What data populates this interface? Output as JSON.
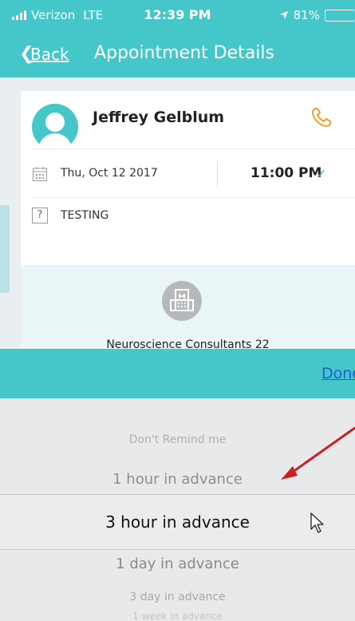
{
  "status_bar": {
    "carrier": "Verizon",
    "network": "LTE",
    "time": "12:39 PM",
    "battery": "81%",
    "battery_level": 0.81
  },
  "nav": {
    "back_label": "Back",
    "title": "Appointment Details"
  },
  "appointment": {
    "patient_name": "Jeffrey Gelblum",
    "date": "Thu, Oct 12  2017",
    "time": "11:00 PM",
    "note": "TESTING",
    "clinic_name": "Neuroscience Consultants 22"
  },
  "picker": {
    "done_label": "Done",
    "options": [
      "Don't Remind me",
      "1 hour in advance",
      "3 hour in advance",
      "1 day in advance",
      "3 day in advance",
      "1 week in advance"
    ],
    "selected": "3 hour in advance"
  },
  "icons": {
    "back": "chevron-left-icon",
    "phone": "phone-icon",
    "calendar": "calendar-icon",
    "question": "question-icon",
    "hospital": "hospital-icon",
    "check": "check-icon"
  },
  "colors": {
    "accent": "#45c7c9",
    "phone_icon": "#f0a030",
    "check": "#3cba54",
    "annotation_arrow": "#cc1f1f"
  }
}
